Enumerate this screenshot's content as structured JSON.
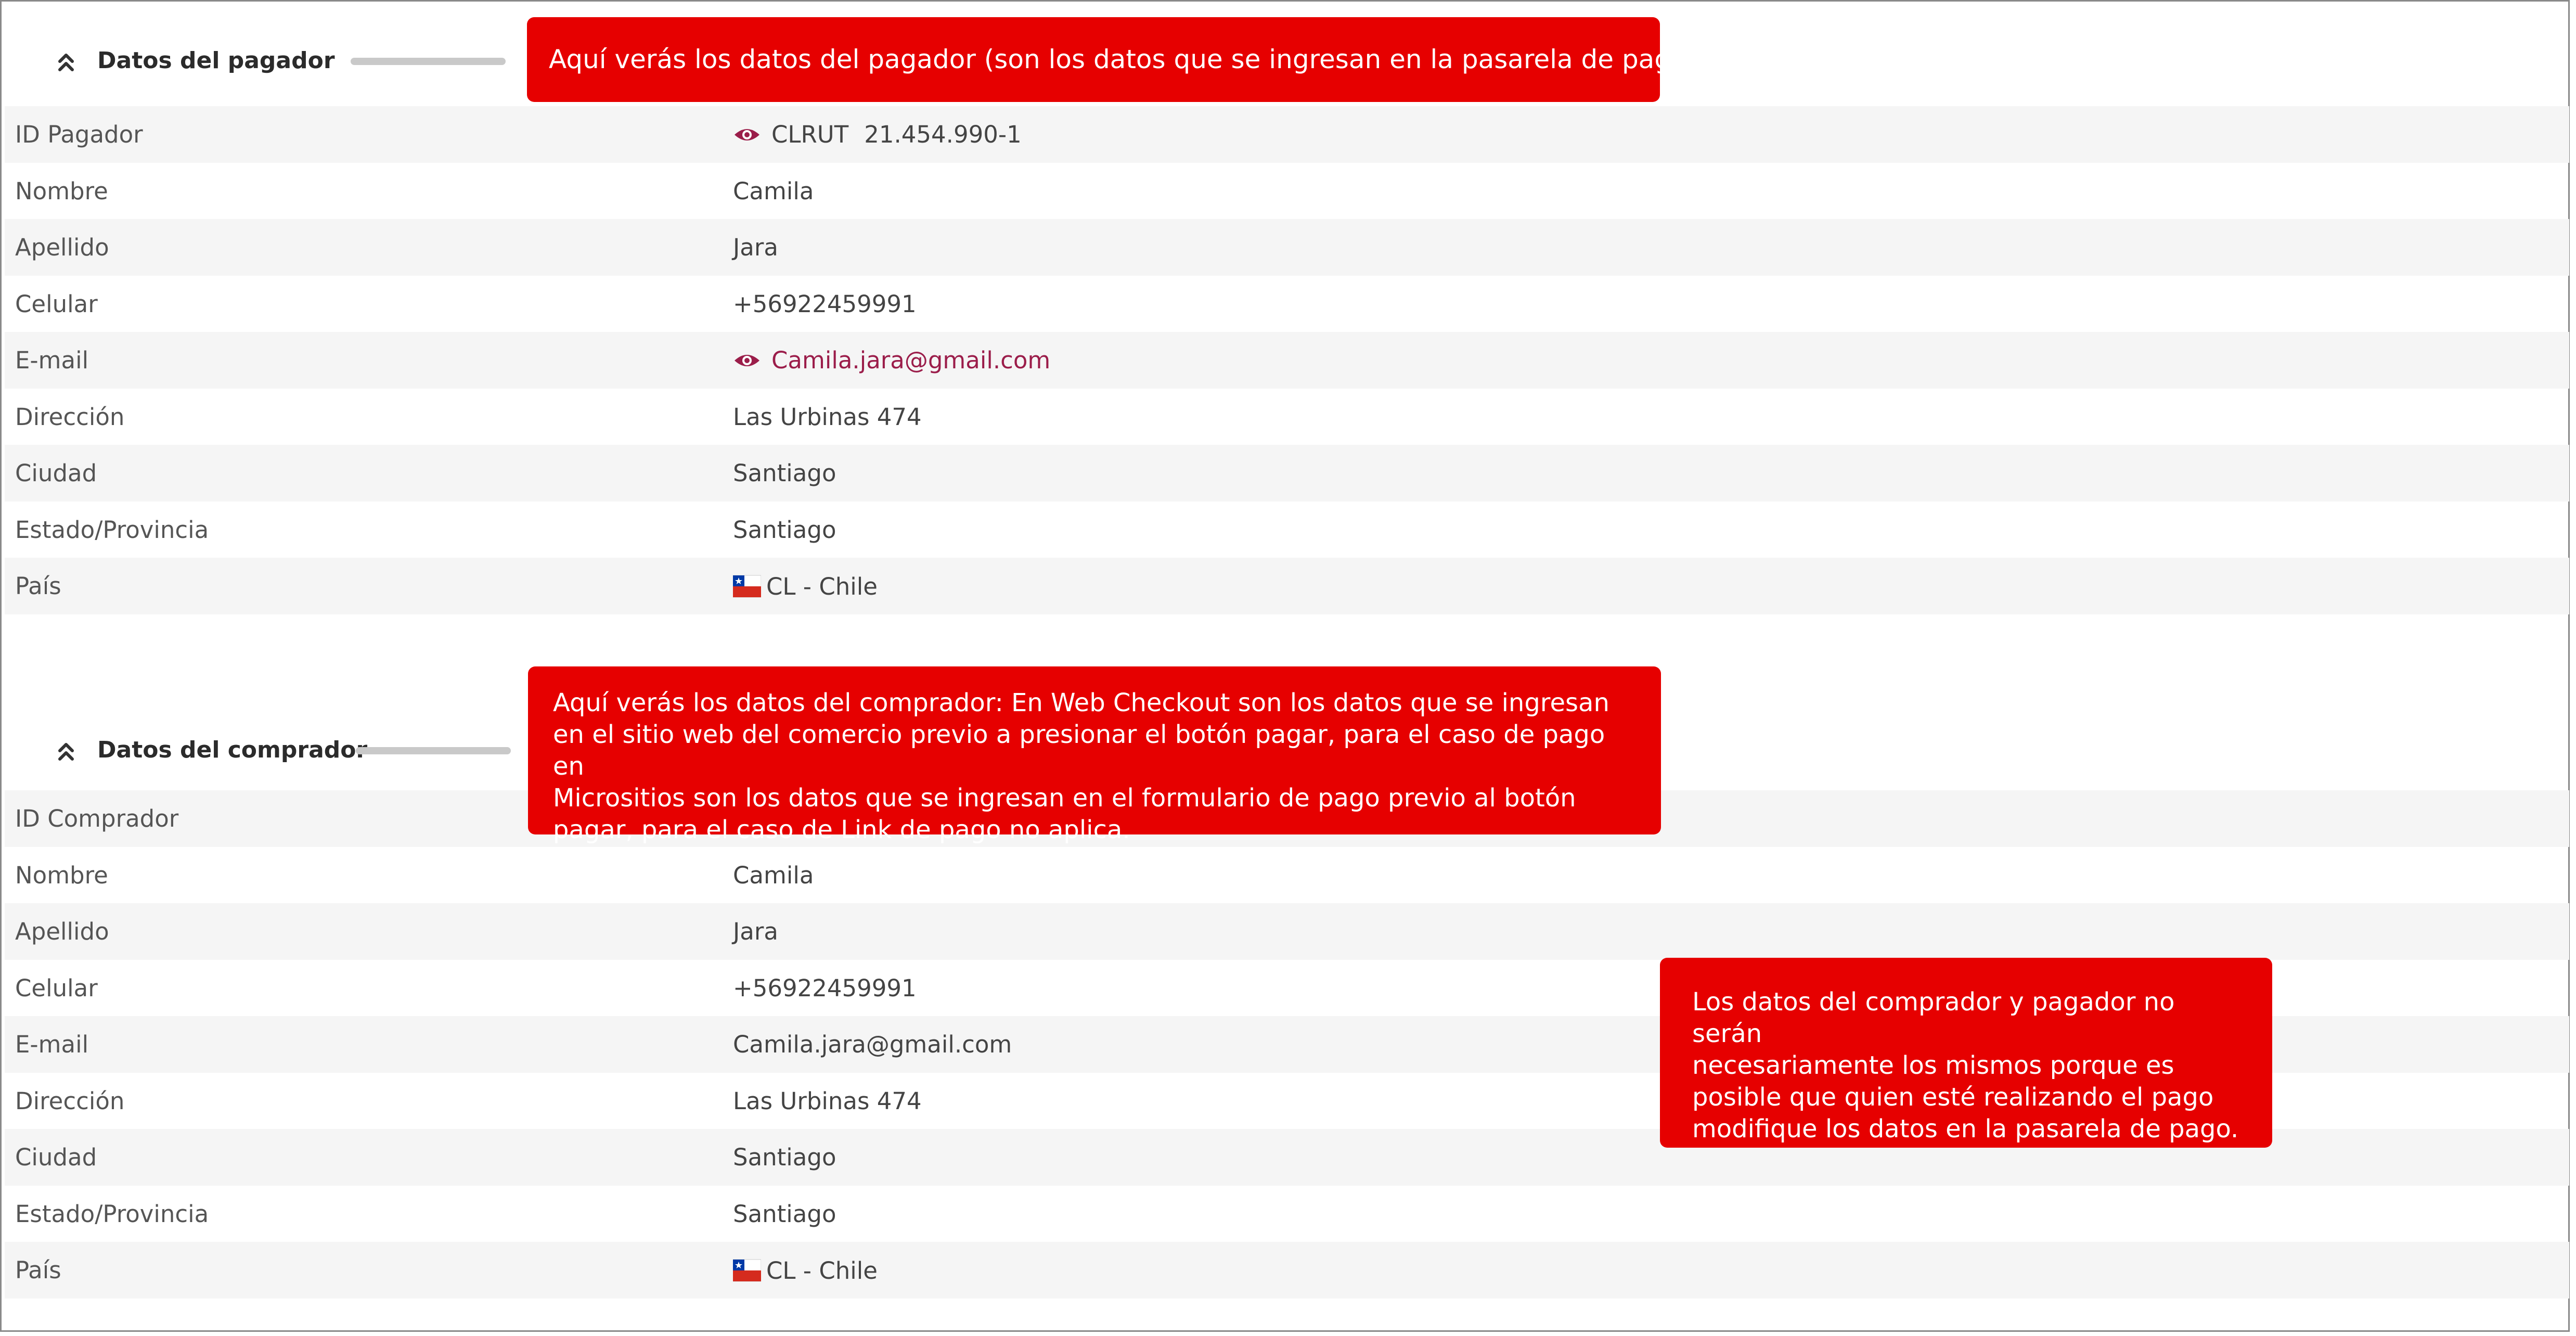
{
  "colors": {
    "callout": "#e60000",
    "link": "#9b1d4a",
    "row_alt": "#f5f5f5"
  },
  "pagador": {
    "title": "Datos del pagador",
    "rows": [
      {
        "label": "ID Pagador",
        "doc_type": "CLRUT",
        "value": "21.454.990-1",
        "icon": "eye-icon"
      },
      {
        "label": "Nombre",
        "value": "Camila"
      },
      {
        "label": "Apellido",
        "value": "Jara"
      },
      {
        "label": "Celular",
        "value": "+56922459991"
      },
      {
        "label": "E-mail",
        "value": "Camila.jara@gmail.com",
        "icon": "eye-icon"
      },
      {
        "label": "Dirección",
        "value": "Las Urbinas 474"
      },
      {
        "label": "Ciudad",
        "value": "Santiago"
      },
      {
        "label": "Estado/Provincia",
        "value": "Santiago"
      },
      {
        "label": "País",
        "value": "CL - Chile",
        "icon": "chile-flag-icon"
      }
    ]
  },
  "comprador": {
    "title": "Datos del comprador",
    "rows": [
      {
        "label": "ID Comprador",
        "value": ""
      },
      {
        "label": "Nombre",
        "value": "Camila"
      },
      {
        "label": "Apellido",
        "value": "Jara"
      },
      {
        "label": "Celular",
        "value": "+56922459991"
      },
      {
        "label": "E-mail",
        "value": "Camila.jara@gmail.com"
      },
      {
        "label": "Dirección",
        "value": "Las Urbinas 474"
      },
      {
        "label": "Ciudad",
        "value": "Santiago"
      },
      {
        "label": "Estado/Provincia",
        "value": "Santiago"
      },
      {
        "label": "País",
        "value": "CL - Chile",
        "icon": "chile-flag-icon"
      }
    ]
  },
  "callouts": {
    "pagador": "Aquí verás los datos del pagador (son los datos que se ingresan en la pasarela de pagos)",
    "comprador_lines": [
      "Aquí verás los datos del comprador: En Web Checkout son los datos que se ingresan",
      "en el sitio web del comercio previo a presionar el botón pagar, para el caso de pago en",
      "Micrositios son los datos que se ingresan en el formulario de pago previo al botón",
      "pagar, para el caso de Link de pago no aplica."
    ],
    "diferencia_lines": [
      "Los datos del comprador y pagador no serán",
      "necesariamente los mismos porque es",
      "posible que quien esté realizando el pago",
      "modifique los datos en la pasarela de pago."
    ]
  }
}
